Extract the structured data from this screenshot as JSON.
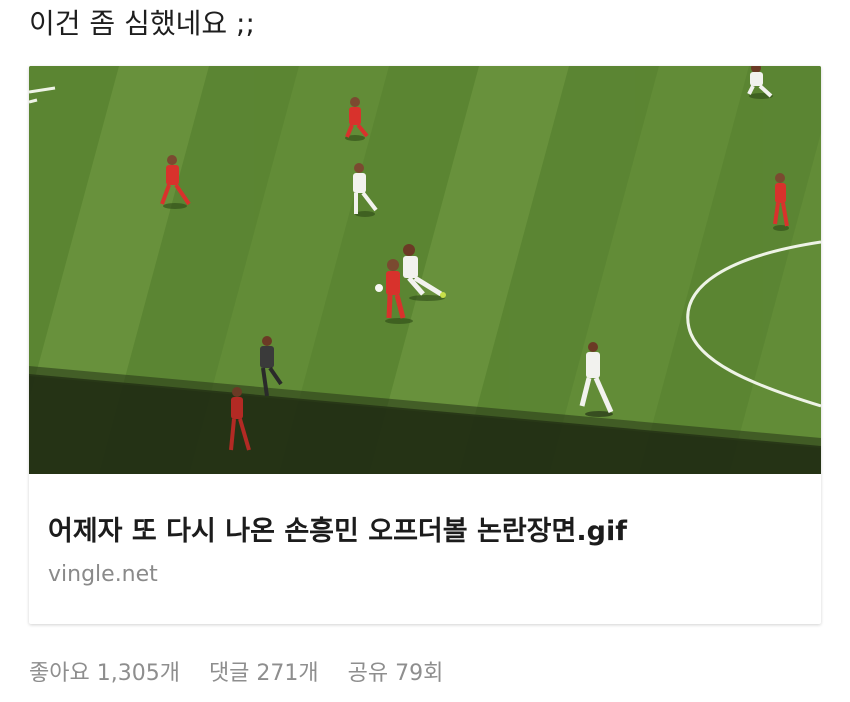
{
  "post": {
    "text": "이건 좀 심했네요 ;;"
  },
  "link_card": {
    "image_icon": "soccer-match-gif-thumbnail",
    "title": "어제자 또 다시 나온 손흥민 오프더볼 논란장면.gif",
    "domain": "vingle.net"
  },
  "stats": {
    "likes": "좋아요 1,305개",
    "comments": "댓글 271개",
    "shares": "공유 79회"
  },
  "colors": {
    "pitch": "#5f8a35",
    "shadow": "#1f2d12",
    "red_team": "#d8322c",
    "white_team": "#f2f2ee",
    "referee": "#3a3a3a",
    "muted_text": "#8e8e8e"
  }
}
